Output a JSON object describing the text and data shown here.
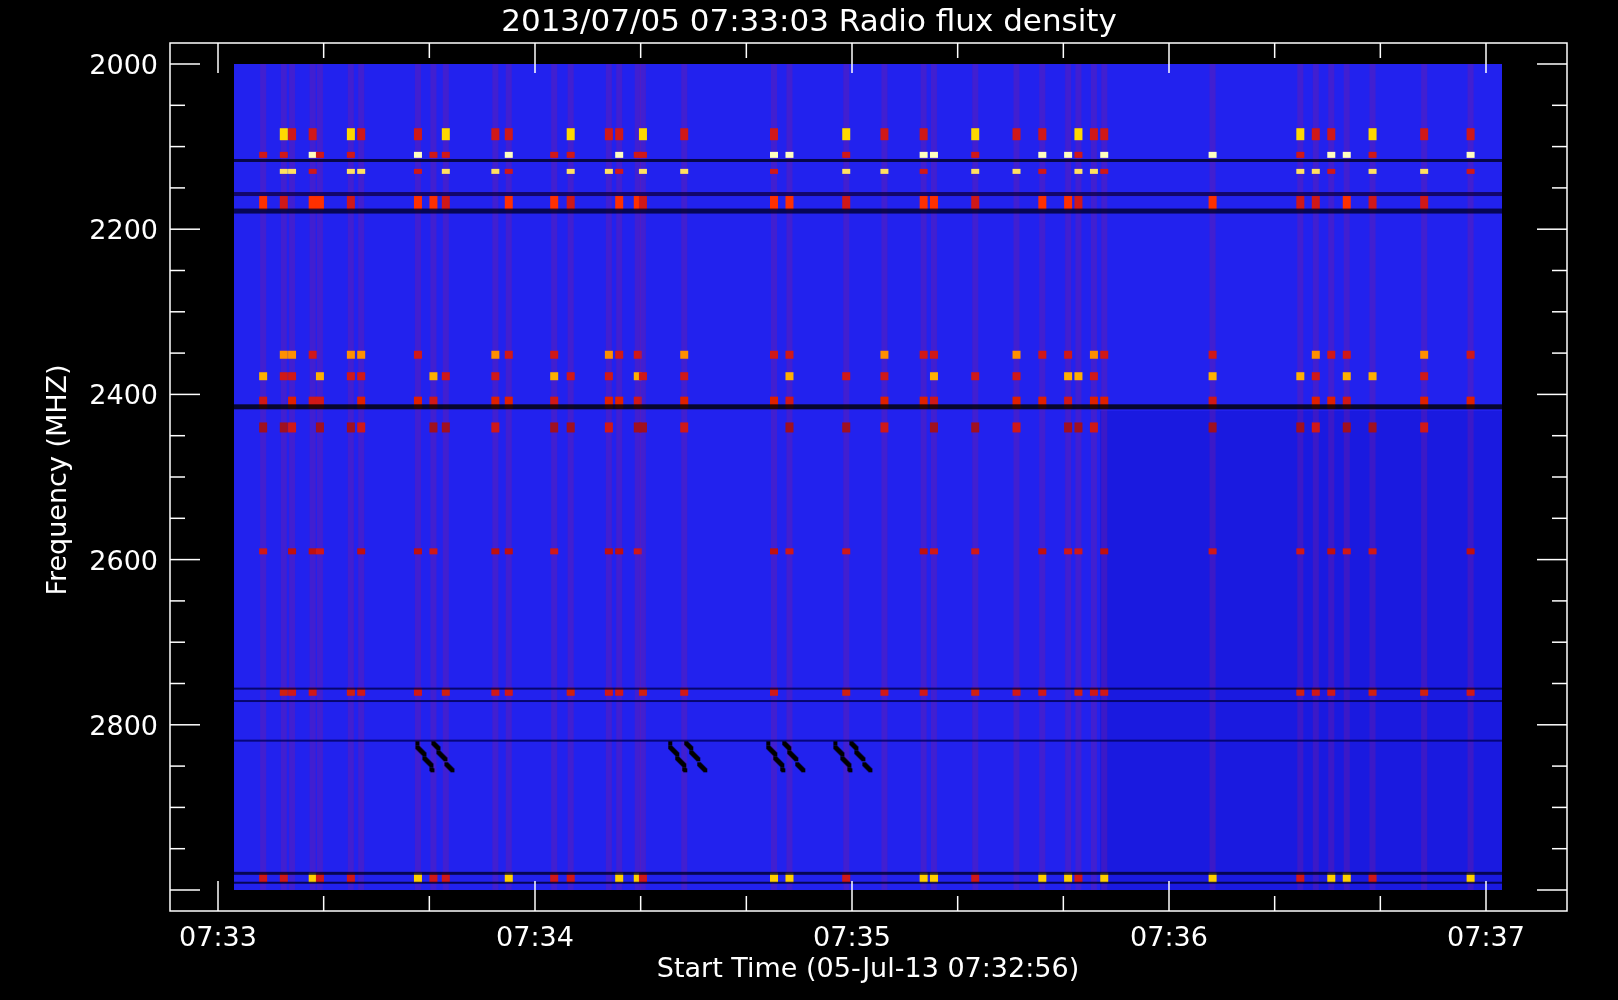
{
  "plot": {
    "title": "2013/07/05 07:33:03 Radio flux density",
    "ylabel": "Frequency (MHZ)",
    "xlabel": "Start Time (05-Jul-13 07:32:56)",
    "yticks": [
      {
        "label": "2000"
      },
      {
        "label": "2200"
      },
      {
        "label": "2400"
      },
      {
        "label": "2600"
      },
      {
        "label": "2800"
      }
    ],
    "xticks": [
      {
        "label": "07:33"
      },
      {
        "label": "07:34"
      },
      {
        "label": "07:35"
      },
      {
        "label": "07:36"
      },
      {
        "label": "07:37"
      }
    ]
  }
}
